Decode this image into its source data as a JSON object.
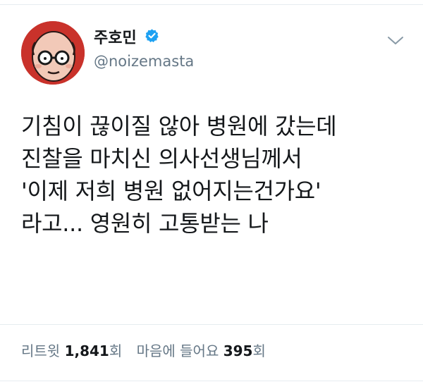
{
  "profile": {
    "display_name": "주호민",
    "handle": "@noizemasta",
    "verified": true,
    "avatar_icon": "cartoon-face-avatar",
    "verified_icon": "verified-badge-icon",
    "menu_icon": "chevron-down-icon"
  },
  "tweet": {
    "text": "기침이 끊이질 않아 병원에 갔는데\n진찰을 마치신 의사선생님께서\n'이제 저희 병원 없어지는건가요'\n라고... 영원히 고통받는 나"
  },
  "stats": {
    "retweets_label": "리트윗",
    "retweets_count": "1,841",
    "retweets_unit": "회",
    "likes_label": "마음에 들어요",
    "likes_count": "395",
    "likes_unit": "회"
  },
  "colors": {
    "verified_blue": "#1da1f2",
    "secondary_text": "#657786",
    "primary_text": "#14171a",
    "avatar_bg": "#c9322b"
  }
}
